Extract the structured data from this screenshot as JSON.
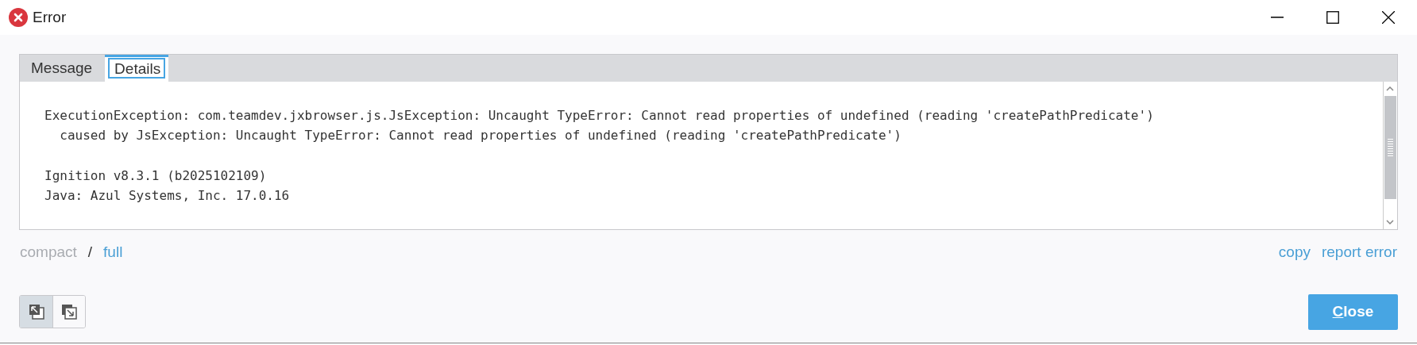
{
  "window": {
    "title": "Error"
  },
  "tabs": [
    {
      "label": "Message",
      "selected": false
    },
    {
      "label": "Details",
      "selected": true
    }
  ],
  "details": {
    "paragraphs": [
      [
        "ExecutionException: com.teamdev.jxbrowser.js.JsException: Uncaught TypeError: Cannot read properties of undefined (reading 'createPathPredicate')",
        "  caused by JsException: Uncaught TypeError: Cannot read properties of undefined (reading 'createPathPredicate')"
      ],
      [
        "Ignition v8.3.1 (b2025102109)",
        "Java: Azul Systems, Inc. 17.0.16"
      ]
    ]
  },
  "view_options": [
    {
      "label": "compact",
      "selected": true
    },
    {
      "label": "full",
      "selected": false
    }
  ],
  "separator": "/",
  "links": [
    "copy",
    "report error"
  ],
  "toggle_buttons": [
    {
      "pressed": true
    },
    {
      "pressed": false
    }
  ],
  "close_button": {
    "label": "Close"
  }
}
